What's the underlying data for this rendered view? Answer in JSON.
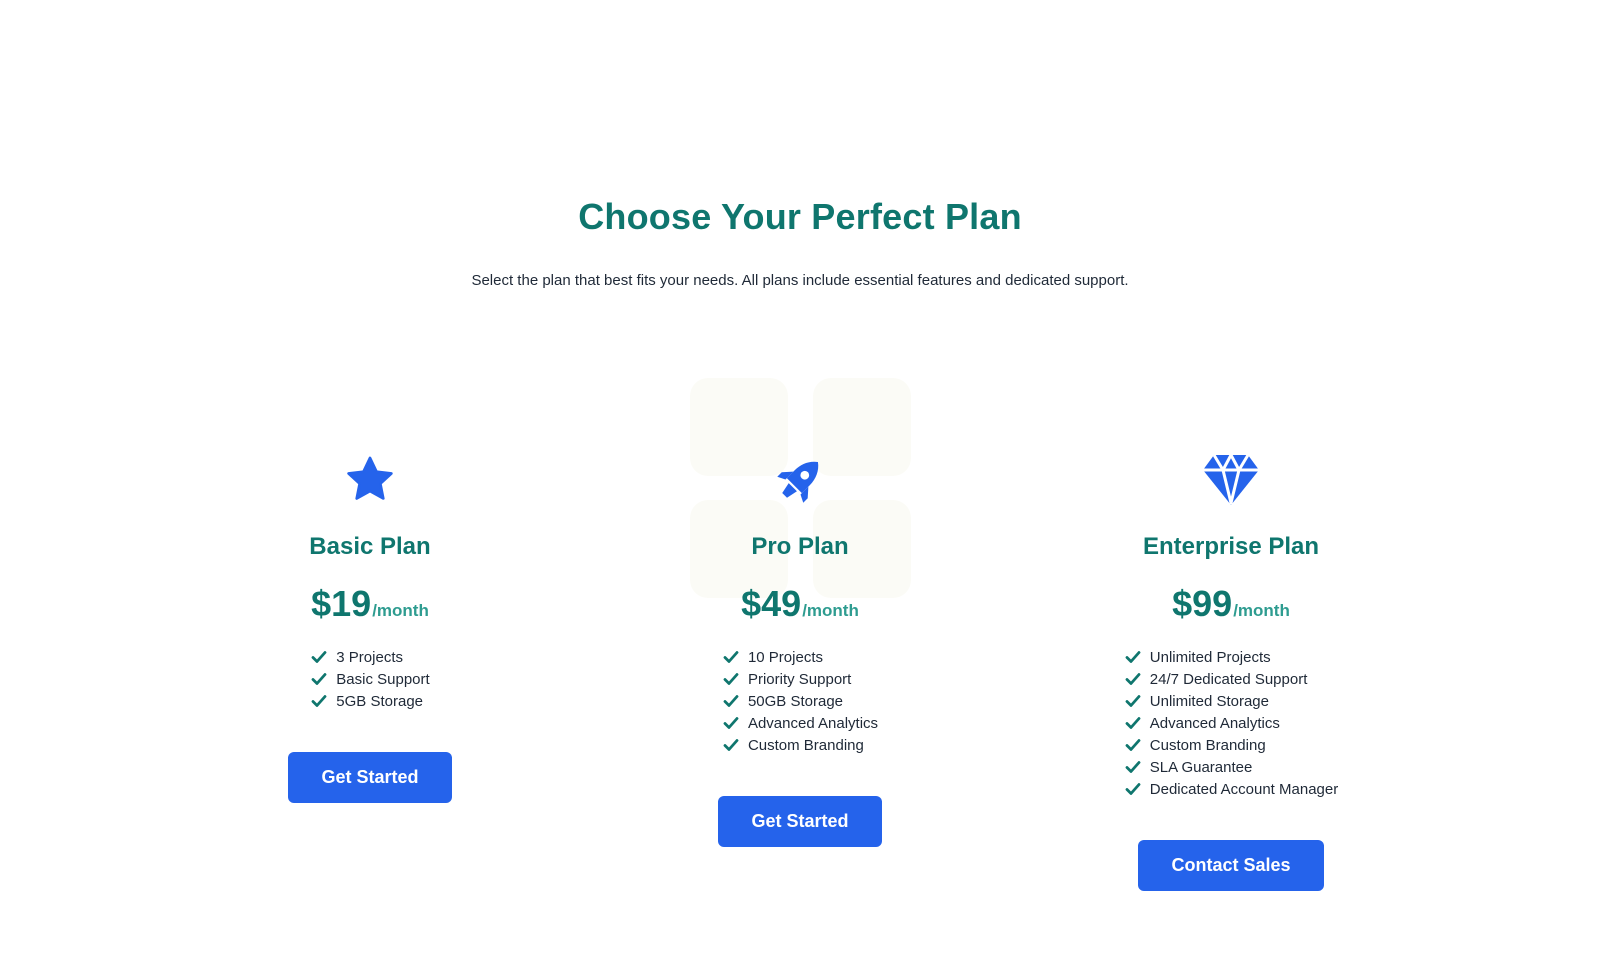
{
  "header": {
    "title": "Choose Your Perfect Plan",
    "subtitle": "Select the plan that best fits your needs. All plans include essential features and dedicated support."
  },
  "colors": {
    "heading": "#0f766e",
    "accent": "#2563eb",
    "check": "#0f766e",
    "text": "#1f2937"
  },
  "plans": [
    {
      "icon": "star-icon",
      "name": "Basic Plan",
      "price": "$19",
      "period": "/month",
      "features": [
        "3 Projects",
        "Basic Support",
        "5GB Storage"
      ],
      "cta": "Get Started"
    },
    {
      "icon": "rocket-icon",
      "name": "Pro Plan",
      "price": "$49",
      "period": "/month",
      "features": [
        "10 Projects",
        "Priority Support",
        "50GB Storage",
        "Advanced Analytics",
        "Custom Branding"
      ],
      "cta": "Get Started"
    },
    {
      "icon": "diamond-icon",
      "name": "Enterprise Plan",
      "price": "$99",
      "period": "/month",
      "features": [
        "Unlimited Projects",
        "24/7 Dedicated Support",
        "Unlimited Storage",
        "Advanced Analytics",
        "Custom Branding",
        "SLA Guarantee",
        "Dedicated Account Manager"
      ],
      "cta": "Contact Sales"
    }
  ]
}
